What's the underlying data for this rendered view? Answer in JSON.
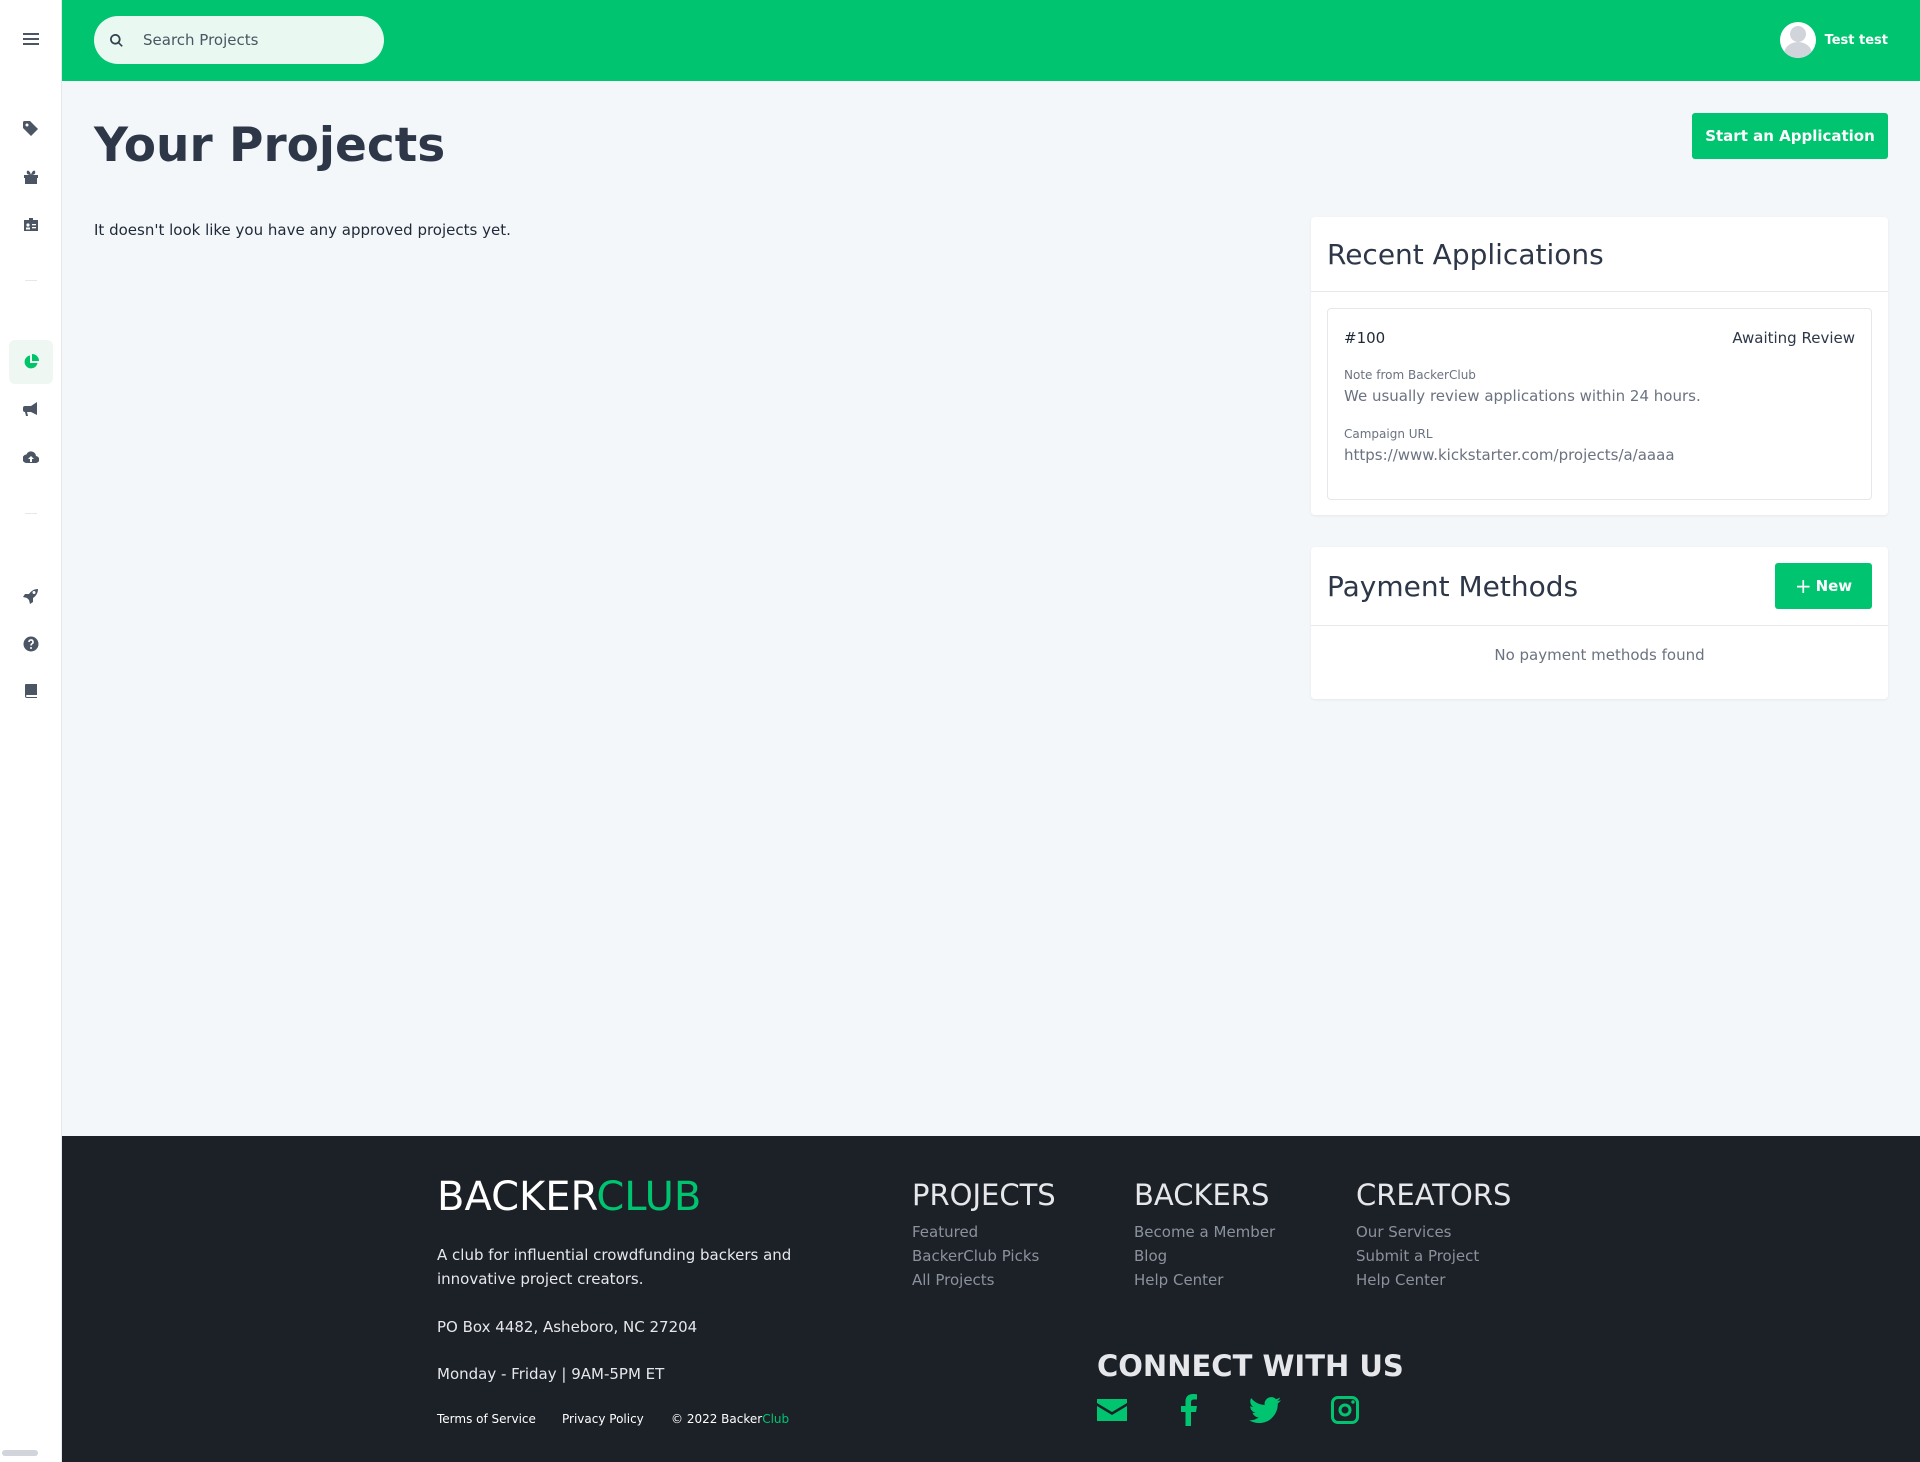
{
  "topbar": {
    "search_placeholder": "Search Projects",
    "user_name": "Test test"
  },
  "sidebar": {
    "items": [
      {
        "icon": "tag-icon"
      },
      {
        "icon": "gift-icon"
      },
      {
        "icon": "id-card-icon"
      },
      {
        "icon": "chart-pie-icon",
        "active": true
      },
      {
        "icon": "bullhorn-icon"
      },
      {
        "icon": "cloud-upload-icon"
      },
      {
        "icon": "rocket-icon"
      },
      {
        "icon": "question-circle-icon"
      },
      {
        "icon": "book-icon"
      }
    ]
  },
  "main": {
    "title": "Your Projects",
    "start_button": "Start an Application",
    "empty_message": "It doesn't look like you have any approved projects yet."
  },
  "recent_applications": {
    "title": "Recent Applications",
    "items": [
      {
        "id": "#100",
        "status": "Awaiting Review",
        "note_label": "Note from BackerClub",
        "note": "We usually review applications within 24 hours.",
        "url_label": "Campaign URL",
        "url": "https://www.kickstarter.com/projects/a/aaaa"
      }
    ]
  },
  "payment_methods": {
    "title": "Payment Methods",
    "new_button": "New",
    "empty": "No payment methods found"
  },
  "footer": {
    "logo_part1": "BACKER",
    "logo_part2": "CLUB",
    "tagline": "A club for influential crowdfunding backers and innovative project creators.",
    "address": "PO Box 4482, Asheboro, NC 27204",
    "hours": "Monday - Friday | 9AM-5PM ET",
    "terms": "Terms of Service",
    "privacy": "Privacy Policy",
    "copyright_prefix": "© 2022 Backer",
    "copyright_suffix": "Club",
    "columns": [
      {
        "title": "PROJECTS",
        "links": [
          "Featured",
          "BackerClub Picks",
          "All Projects"
        ]
      },
      {
        "title": "BACKERS",
        "links": [
          "Become a Member",
          "Blog",
          "Help Center"
        ]
      },
      {
        "title": "CREATORS",
        "links": [
          "Our Services",
          "Submit a Project",
          "Help Center"
        ]
      }
    ],
    "connect_title": "CONNECT WITH US",
    "social_icons": [
      "envelope-icon",
      "facebook-icon",
      "twitter-icon",
      "instagram-icon"
    ]
  },
  "colors": {
    "brand": "#00c46f",
    "footer_bg": "#1c2128",
    "page_bg": "#f4f7fa"
  }
}
